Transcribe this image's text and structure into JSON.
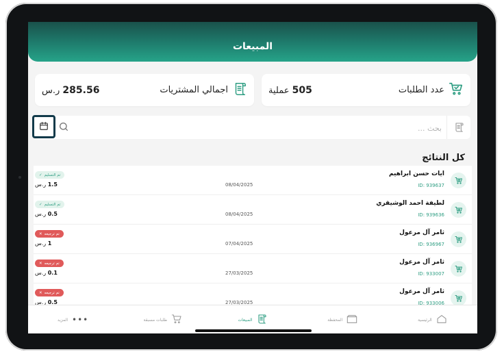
{
  "header": {
    "title": "المبيعات"
  },
  "stats": {
    "orders": {
      "label": "عدد الطلبات",
      "value": "505",
      "unit": "عملية"
    },
    "purchases": {
      "label": "اجمالي المشتريات",
      "value": "285.56",
      "unit": "ر.س"
    }
  },
  "search": {
    "placeholder": "بحث ..."
  },
  "results": {
    "title": "كل النتائج",
    "rows": [
      {
        "name": "ايات حسن ابراهيم",
        "id": "ID: 939637",
        "date": "08/04/2025",
        "status": "تم التسليم",
        "status_type": "done",
        "amount": "1.5",
        "currency": "ر.س"
      },
      {
        "name": "لطيفة احمد الوشيقري",
        "id": "ID: 939636",
        "date": "08/04/2025",
        "status": "تم التسليم",
        "status_type": "done",
        "amount": "0.5",
        "currency": "ر.س"
      },
      {
        "name": "ثامر آل مرعول",
        "id": "ID: 936967",
        "date": "07/04/2025",
        "status": "تم ترجيعه",
        "status_type": "back",
        "amount": "1",
        "currency": "ر.س"
      },
      {
        "name": "ثامر آل مرعول",
        "id": "ID: 933007",
        "date": "27/03/2025",
        "status": "تم ترجيعه",
        "status_type": "back",
        "amount": "0.1",
        "currency": "ر.س"
      },
      {
        "name": "ثامر آل مرعول",
        "id": "ID: 933006",
        "date": "27/03/2025",
        "status": "تم ترجيعه",
        "status_type": "back",
        "amount": "0.5",
        "currency": "ر.س"
      }
    ]
  },
  "nav": {
    "home": "الرئيسية",
    "wallet": "المحفظة",
    "sales": "المبيعات",
    "preorders": "طلبات مسبقة",
    "more": "المزيد"
  },
  "colors": {
    "accent": "#2f9e83",
    "header_dark": "#1a514b",
    "returned": "#e05a5a"
  }
}
